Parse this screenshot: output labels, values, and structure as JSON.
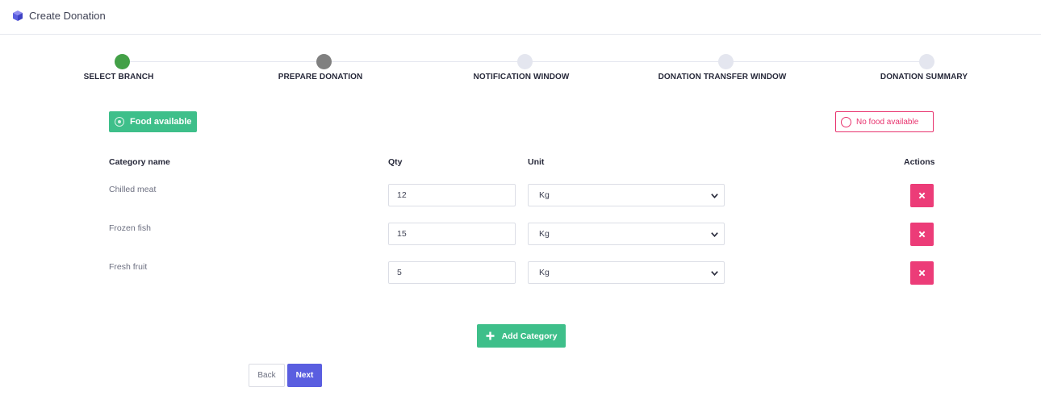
{
  "header": {
    "title": "Create Donation",
    "icon": "cube-icon"
  },
  "stepper": {
    "steps": [
      {
        "label": "SELECT BRANCH",
        "state": "completed",
        "color": "#43a047"
      },
      {
        "label": "PREPARE DONATION",
        "state": "current",
        "color": "#808080"
      },
      {
        "label": "NOTIFICATION WINDOW",
        "state": "pending",
        "color": "#e4e6ef"
      },
      {
        "label": "DONATION TRANSFER WINDOW",
        "state": "pending",
        "color": "#e4e6ef"
      },
      {
        "label": "DONATION SUMMARY",
        "state": "pending",
        "color": "#e4e6ef"
      }
    ]
  },
  "food_toggle": {
    "available_label": "Food available",
    "unavailable_label": "No food available",
    "selected": "available"
  },
  "table": {
    "headers": {
      "category": "Category name",
      "qty": "Qty",
      "unit": "Unit",
      "actions": "Actions"
    },
    "rows": [
      {
        "category": "Chilled meat",
        "qty": "12",
        "unit": "Kg"
      },
      {
        "category": "Frozen fish",
        "qty": "15",
        "unit": "Kg"
      },
      {
        "category": "Fresh fruit",
        "qty": "5",
        "unit": "Kg"
      }
    ]
  },
  "actions": {
    "add_category": "Add Category",
    "back": "Back",
    "next": "Next"
  },
  "colors": {
    "green": "#3ebf8a",
    "pink": "#ec3c78",
    "indigo": "#5a5ee0"
  }
}
